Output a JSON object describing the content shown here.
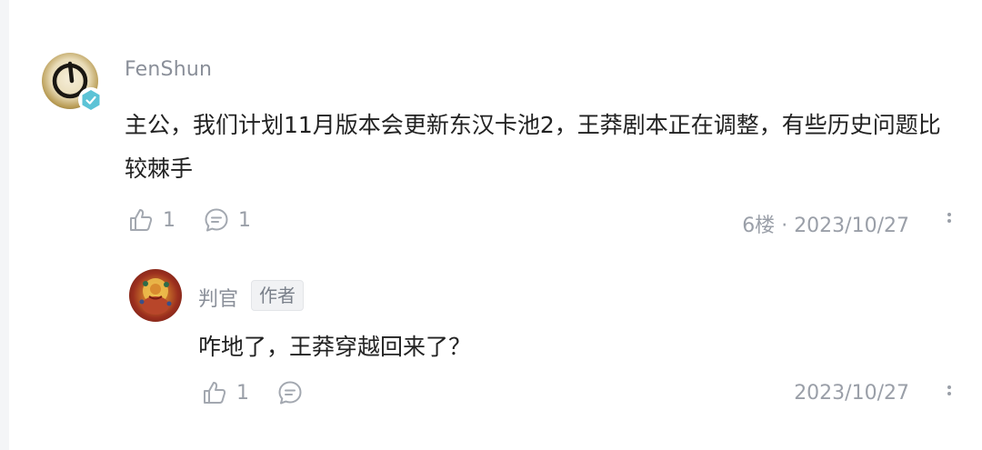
{
  "comment": {
    "username": "FenShun",
    "text": "主公，我们计划11月版本会更新东汉卡池2，王莽剧本正在调整，有些历史问题比较棘手",
    "like_count": "1",
    "reply_count": "1",
    "floor": "6楼",
    "separator": "·",
    "date": "2023/10/27",
    "badge_icon": "verified-check-icon",
    "badge_color": "#5cc3d6"
  },
  "reply": {
    "username": "判官",
    "author_tag": "作者",
    "text": "咋地了，王莽穿越回来了？",
    "like_count": "1",
    "date": "2023/10/27"
  },
  "colors": {
    "text_primary": "#222222",
    "text_secondary": "#9a9fa8",
    "username": "#8a8f99",
    "icon": "#a3a8b0"
  }
}
